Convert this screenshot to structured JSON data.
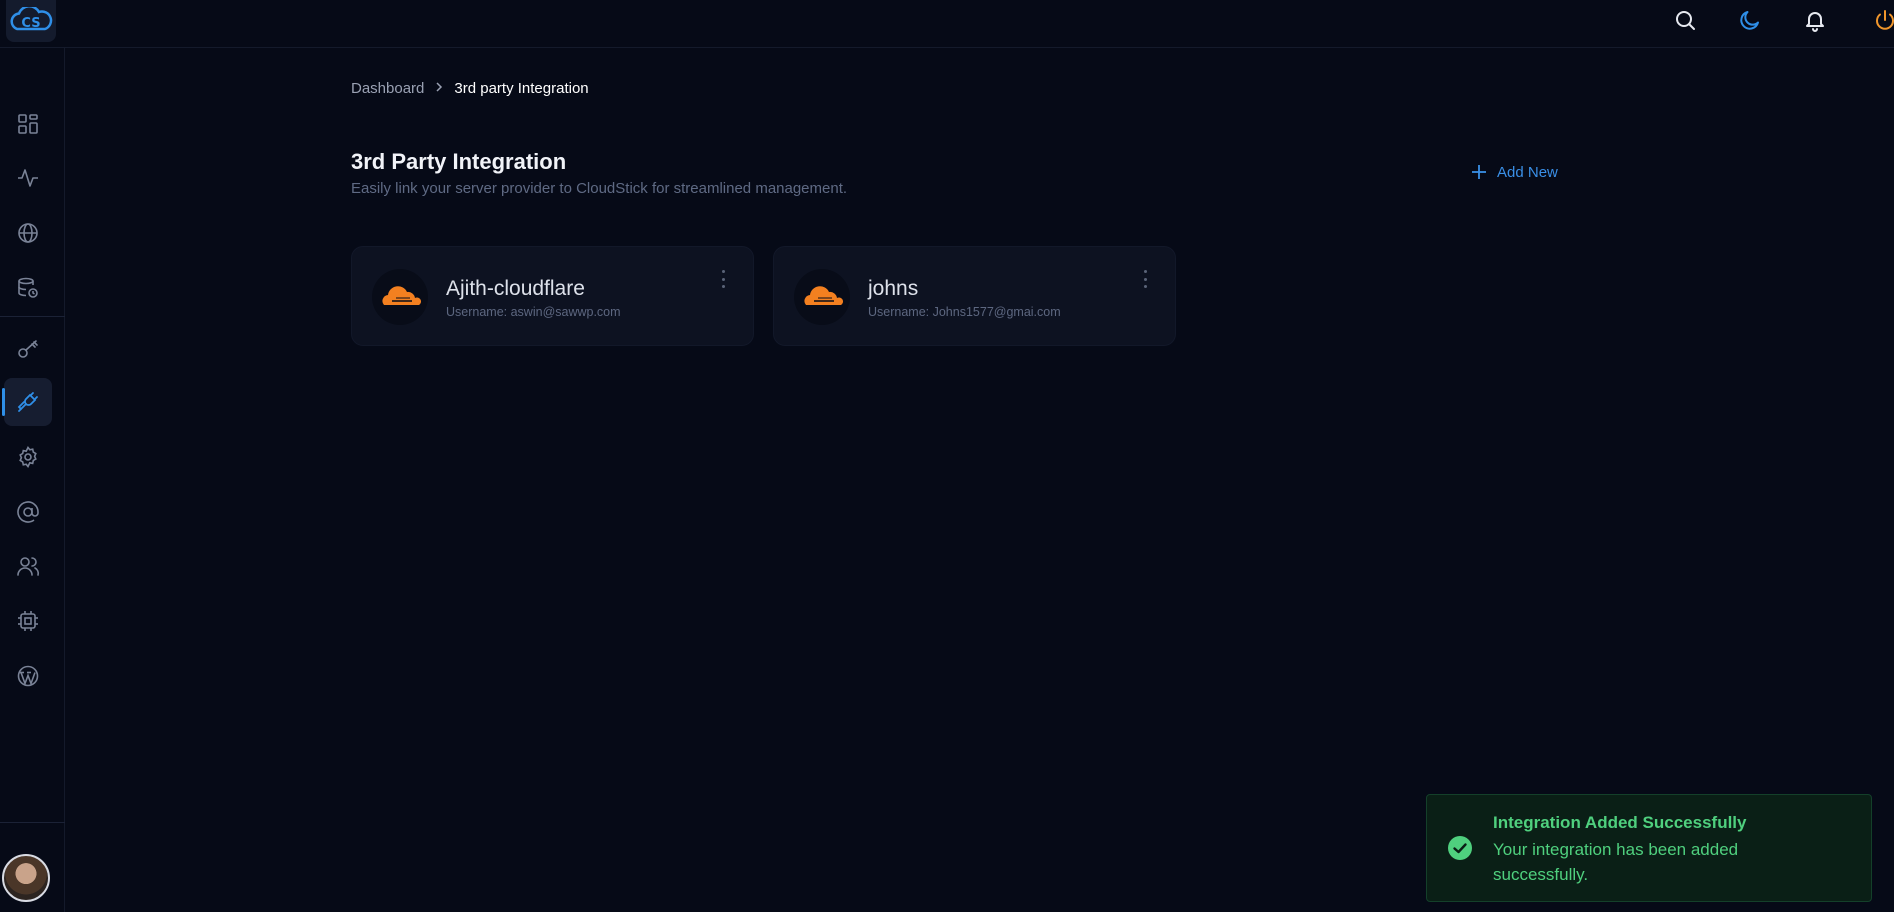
{
  "app": {
    "logo_text": "CS",
    "colors": {
      "background": "#060a17",
      "accent": "#2f8fe8",
      "cloudflare": "#f38020",
      "success": "#4fd07e",
      "power": "#f0962c"
    }
  },
  "topbar": {
    "icons": [
      "search-icon",
      "moon-icon",
      "bell-icon",
      "power-icon"
    ]
  },
  "sidebar": {
    "items": [
      {
        "icon": "dashboard-icon",
        "active": false
      },
      {
        "icon": "activity-icon",
        "active": false
      },
      {
        "icon": "globe-icon",
        "active": false
      },
      {
        "icon": "database-backup-icon",
        "active": false
      },
      {
        "icon": "key-icon",
        "active": false
      },
      {
        "icon": "plug-icon",
        "active": true
      },
      {
        "icon": "gear-icon",
        "active": false
      },
      {
        "icon": "at-sign-icon",
        "active": false
      },
      {
        "icon": "users-icon",
        "active": false
      },
      {
        "icon": "cpu-icon",
        "active": false
      },
      {
        "icon": "wordpress-icon",
        "active": false
      }
    ]
  },
  "breadcrumb": {
    "home": "Dashboard",
    "current": "3rd party Integration"
  },
  "page": {
    "title": "3rd Party Integration",
    "subtitle": "Easily link your server provider to CloudStick for streamlined management.",
    "add_new_label": "Add New"
  },
  "integrations": [
    {
      "name": "Ajith-cloudflare",
      "username": "Username: aswin@sawwp.com",
      "provider_icon": "cloudflare-icon"
    },
    {
      "name": "johns",
      "username": "Username: Johns1577@gmai.com",
      "provider_icon": "cloudflare-icon"
    }
  ],
  "toast": {
    "title": "Integration Added Successfully",
    "message": "Your integration has been added successfully."
  }
}
